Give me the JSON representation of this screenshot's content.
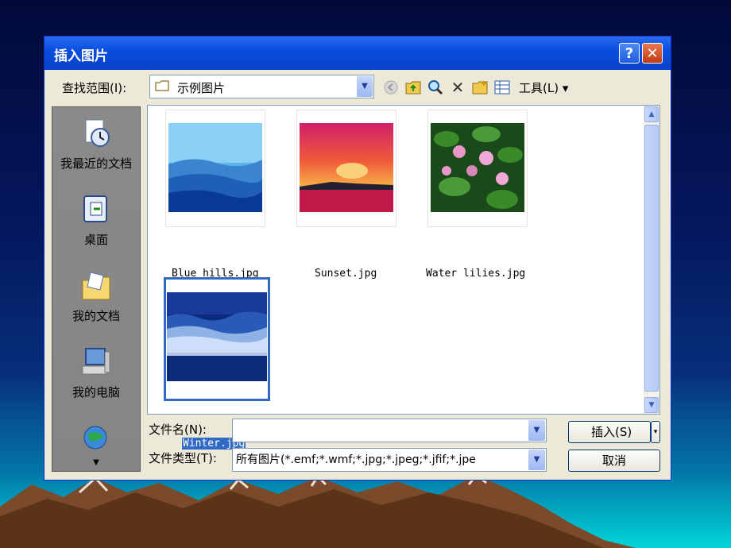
{
  "window": {
    "title": "插入图片",
    "help_label": "?",
    "close_label": "✕"
  },
  "toolbar": {
    "look_in_label": "查找范围(I):",
    "look_in_value": "示例图片",
    "tools_label": "工具(L) ▾"
  },
  "places": [
    {
      "label": "我最近的文档",
      "icon": "recent-documents-icon"
    },
    {
      "label": "桌面",
      "icon": "desktop-icon"
    },
    {
      "label": "我的文档",
      "icon": "my-documents-icon"
    },
    {
      "label": "我的电脑",
      "icon": "my-computer-icon"
    },
    {
      "label": "",
      "icon": "network-places-icon"
    }
  ],
  "files": [
    {
      "name": "Blue hills.jpg",
      "selected": false
    },
    {
      "name": "Sunset.jpg",
      "selected": false
    },
    {
      "name": "Water lilies.jpg",
      "selected": false
    },
    {
      "name": "Winter.jpg",
      "selected": true
    }
  ],
  "footer": {
    "filename_label": "文件名(N):",
    "filename_value": "",
    "filetype_label": "文件类型(T):",
    "filetype_value": "所有图片(*.emf;*.wmf;*.jpg;*.jpeg;*.jfif;*.jpe",
    "insert_label": "插入(S)",
    "cancel_label": "取消"
  },
  "colors": {
    "titlebar": "#0a4ee0",
    "selection": "#316ac5",
    "dialog_bg": "#ece9d8"
  }
}
